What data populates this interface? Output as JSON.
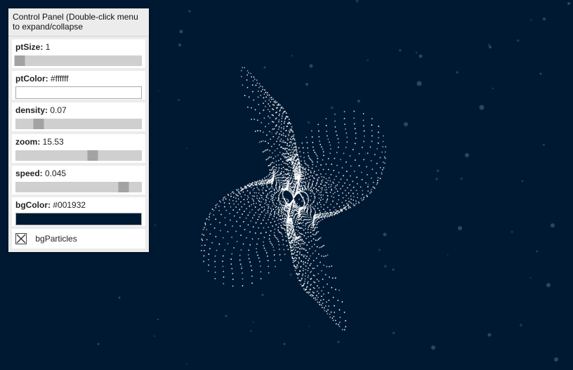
{
  "background": {
    "color": "#001932"
  },
  "panel": {
    "title": "Control Panel (Double-click menu to expand/collapse",
    "controls": {
      "ptSize": {
        "label": "ptSize:",
        "value": "1",
        "level": 0.0
      },
      "ptColor": {
        "label": "ptColor:",
        "value": "#ffffff",
        "swatch": "#ffffff"
      },
      "density": {
        "label": "density:",
        "value": "0.07",
        "level": 0.16
      },
      "zoom": {
        "label": "zoom:",
        "value": "15.53",
        "level": 0.62
      },
      "speed": {
        "label": "speed:",
        "value": "0.045",
        "level": 0.88
      },
      "bgColor": {
        "label": "bgColor:",
        "value": "#001932",
        "swatch": "#001932"
      },
      "bgParticles": {
        "label": "bgParticles",
        "checked": true
      }
    }
  },
  "icons": {
    "checkbox_mark": "x-mark-icon"
  }
}
